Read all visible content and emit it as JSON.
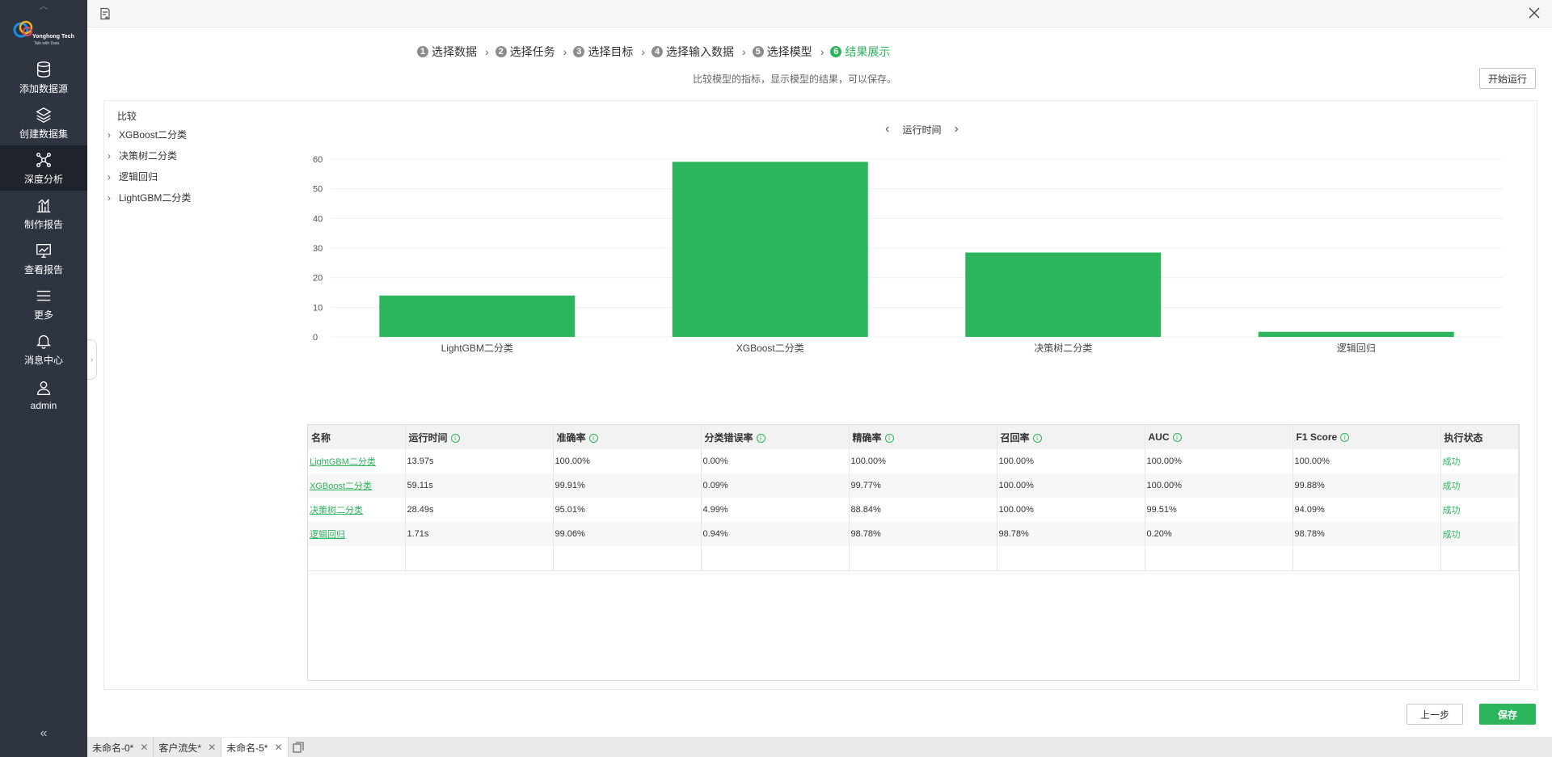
{
  "sidebar": {
    "logo_text": "Yonghong Tech",
    "logo_tagline": "Talk with Data",
    "items": [
      {
        "label": "添加数据源",
        "icon": "database-icon"
      },
      {
        "label": "创建数据集",
        "icon": "layers-icon"
      },
      {
        "label": "深度分析",
        "icon": "network-icon"
      },
      {
        "label": "制作报告",
        "icon": "bar-chart-icon"
      },
      {
        "label": "查看报告",
        "icon": "line-chart-icon"
      },
      {
        "label": "更多",
        "icon": "menu-icon"
      },
      {
        "label": "消息中心",
        "icon": "bell-icon"
      },
      {
        "label": "admin",
        "icon": "user-icon"
      }
    ],
    "active_index": 2
  },
  "wizard": {
    "steps": [
      {
        "num": "1",
        "label": "选择数据"
      },
      {
        "num": "2",
        "label": "选择任务"
      },
      {
        "num": "3",
        "label": "选择目标"
      },
      {
        "num": "4",
        "label": "选择输入数据"
      },
      {
        "num": "5",
        "label": "选择模型"
      },
      {
        "num": "6",
        "label": "结果展示"
      }
    ],
    "active_step": 6,
    "subtitle": "比较模型的指标，显示模型的结果，可以保存。",
    "run_button": "开始运行"
  },
  "tree": {
    "root": "比较",
    "items": [
      "XGBoost二分类",
      "决策树二分类",
      "逻辑回归",
      "LightGBM二分类"
    ]
  },
  "chart_nav": {
    "title": "运行时间",
    "prev": "‹",
    "next": "›"
  },
  "chart_data": {
    "type": "bar",
    "categories": [
      "LightGBM二分类",
      "XGBoost二分类",
      "决策树二分类",
      "逻辑回归"
    ],
    "values": [
      13.97,
      59.11,
      28.49,
      1.71
    ],
    "yticks": [
      0,
      10,
      20,
      30,
      40,
      50,
      60
    ],
    "ylim": [
      0,
      60
    ],
    "color": "#2db55d",
    "title": "运行时间"
  },
  "table": {
    "headers": [
      {
        "label": "名称",
        "info": false
      },
      {
        "label": "运行时间",
        "info": true
      },
      {
        "label": "准确率",
        "info": true
      },
      {
        "label": "分类错误率",
        "info": true
      },
      {
        "label": "精确率",
        "info": true
      },
      {
        "label": "召回率",
        "info": true
      },
      {
        "label": "AUC",
        "info": true
      },
      {
        "label": "F1 Score",
        "info": true
      },
      {
        "label": "执行状态",
        "info": false
      }
    ],
    "rows": [
      [
        "LightGBM二分类",
        "13.97s",
        "100.00%",
        "0.00%",
        "100.00%",
        "100.00%",
        "100.00%",
        "100.00%",
        "成功"
      ],
      [
        "XGBoost二分类",
        "59.11s",
        "99.91%",
        "0.09%",
        "99.77%",
        "100.00%",
        "100.00%",
        "99.88%",
        "成功"
      ],
      [
        "决策树二分类",
        "28.49s",
        "95.01%",
        "4.99%",
        "88.84%",
        "100.00%",
        "99.51%",
        "94.09%",
        "成功"
      ],
      [
        "逻辑回归",
        "1.71s",
        "99.06%",
        "0.94%",
        "98.78%",
        "98.78%",
        "0.20%",
        "98.78%",
        "成功"
      ]
    ]
  },
  "buttons": {
    "prev": "上一步",
    "save": "保存"
  },
  "doc_tabs": [
    {
      "label": "未命名-0*",
      "active": false
    },
    {
      "label": "客户流失*",
      "active": false
    },
    {
      "label": "未命名-5*",
      "active": true
    }
  ],
  "colors": {
    "accent": "#2db55d",
    "sidebar_bg": "#2e3440"
  }
}
